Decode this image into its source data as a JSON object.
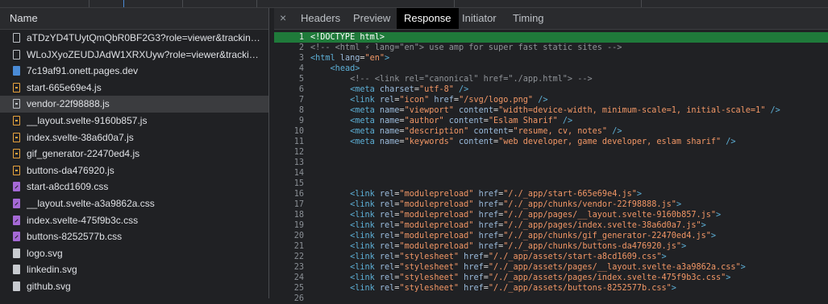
{
  "left_panel": {
    "header": "Name",
    "requests": [
      {
        "name": "aTDzYD4TUytQmQbR0BF2G3?role=viewer&tracking...",
        "icon": "checkbox-icon"
      },
      {
        "name": "WLoJXyoZEUDJAdW1XRXUyw?role=viewer&tracking...",
        "icon": "checkbox-icon"
      },
      {
        "name": "7c19af91.onett.pages.dev",
        "icon": "document-icon"
      },
      {
        "name": "start-665e69e4.js",
        "icon": "script-file-icon"
      },
      {
        "name": "vendor-22f98888.js",
        "icon": "script-file-icon"
      },
      {
        "name": "__layout.svelte-9160b857.js",
        "icon": "script-file-icon"
      },
      {
        "name": "index.svelte-38a6d0a7.js",
        "icon": "script-file-icon"
      },
      {
        "name": "gif_generator-22470ed4.js",
        "icon": "script-file-icon"
      },
      {
        "name": "buttons-da476920.js",
        "icon": "script-file-icon"
      },
      {
        "name": "start-a8cd1609.css",
        "icon": "stylesheet-icon"
      },
      {
        "name": "__layout.svelte-a3a9862a.css",
        "icon": "stylesheet-icon"
      },
      {
        "name": "index.svelte-475f9b3c.css",
        "icon": "stylesheet-icon"
      },
      {
        "name": "buttons-8252577b.css",
        "icon": "stylesheet-icon"
      },
      {
        "name": "logo.svg",
        "icon": "image-file-icon"
      },
      {
        "name": "linkedin.svg",
        "icon": "image-file-icon"
      },
      {
        "name": "github.svg",
        "icon": "image-file-icon"
      }
    ]
  },
  "right_panel": {
    "close_glyph": "×",
    "tabs": [
      "Headers",
      "Preview",
      "Response",
      "Initiator",
      "Timing"
    ],
    "active_tab": "Response"
  },
  "code_lines": [
    {
      "n": "1",
      "text": "<!DOCTYPE html>"
    },
    {
      "n": "2",
      "text": "<!-- <html ⚡ lang=\"en\"> use amp for super fast static sites -->"
    },
    {
      "n": "3",
      "text": "<html lang=\"en\">"
    },
    {
      "n": "4",
      "text": "    <head>"
    },
    {
      "n": "5",
      "text": "        <!-- <link rel=\"canonical\" href=\"./app.html\"> -->"
    },
    {
      "n": "6",
      "text": "        <meta charset=\"utf-8\" />"
    },
    {
      "n": "7",
      "text": "        <link rel=\"icon\" href=\"/svg/logo.png\" />"
    },
    {
      "n": "8",
      "text": "        <meta name=\"viewport\" content=\"width=device-width, minimum-scale=1, initial-scale=1\" />"
    },
    {
      "n": "9",
      "text": "        <meta name=\"author\" content=\"Eslam Sharif\" />"
    },
    {
      "n": "10",
      "text": "        <meta name=\"description\" content=\"resume, cv, notes\" />"
    },
    {
      "n": "11",
      "text": "        <meta name=\"keywords\" content=\"web developer, game developer, eslam sharif\" />"
    },
    {
      "n": "12",
      "text": ""
    },
    {
      "n": "13",
      "text": ""
    },
    {
      "n": "14",
      "text": ""
    },
    {
      "n": "15",
      "text": ""
    },
    {
      "n": "16",
      "text": "        <link rel=\"modulepreload\" href=\"/./_app/start-665e69e4.js\">"
    },
    {
      "n": "17",
      "text": "        <link rel=\"modulepreload\" href=\"/./_app/chunks/vendor-22f98888.js\">"
    },
    {
      "n": "18",
      "text": "        <link rel=\"modulepreload\" href=\"/./_app/pages/__layout.svelte-9160b857.js\">"
    },
    {
      "n": "19",
      "text": "        <link rel=\"modulepreload\" href=\"/./_app/pages/index.svelte-38a6d0a7.js\">"
    },
    {
      "n": "20",
      "text": "        <link rel=\"modulepreload\" href=\"/./_app/chunks/gif_generator-22470ed4.js\">"
    },
    {
      "n": "21",
      "text": "        <link rel=\"modulepreload\" href=\"/./_app/chunks/buttons-da476920.js\">"
    },
    {
      "n": "22",
      "text": "        <link rel=\"stylesheet\" href=\"/./_app/assets/start-a8cd1609.css\">"
    },
    {
      "n": "23",
      "text": "        <link rel=\"stylesheet\" href=\"/./_app/assets/pages/__layout.svelte-a3a9862a.css\">"
    },
    {
      "n": "24",
      "text": "        <link rel=\"stylesheet\" href=\"/./_app/assets/pages/index.svelte-475f9b3c.css\">"
    },
    {
      "n": "25",
      "text": "        <link rel=\"stylesheet\" href=\"/./_app/assets/buttons-8252577b.css\">"
    },
    {
      "n": "26",
      "text": ""
    }
  ],
  "colors": {
    "highlight_line": "#1f7a3a",
    "active_tab_bg": "#000000",
    "tag": "#5db0d7",
    "attribute": "#9bbbdc",
    "value": "#f29766",
    "comment": "#8f9398"
  }
}
